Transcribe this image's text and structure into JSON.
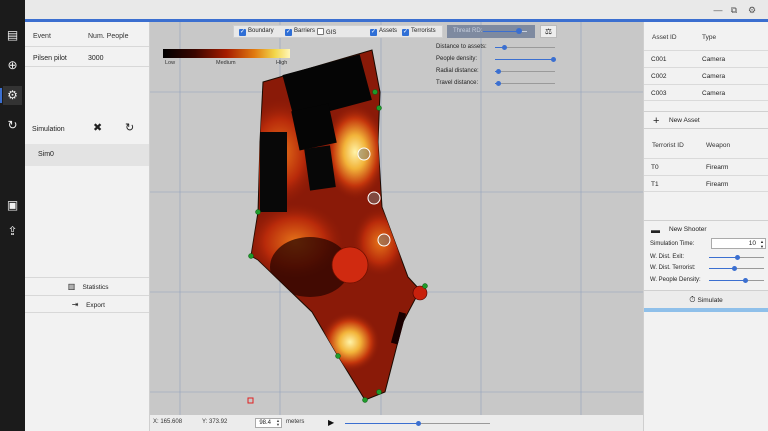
{
  "window_controls": [
    "—",
    "⧉",
    "⚙"
  ],
  "toolbar": {
    "active_index": 2
  },
  "events": {
    "headers": [
      "Event",
      "Num. People"
    ],
    "rows": [
      [
        "Pilsen pilot",
        "3000"
      ]
    ]
  },
  "simulation": {
    "label": "Simulation",
    "items": [
      "Sim0"
    ]
  },
  "actions": {
    "statistics": "Statistics",
    "export": "Export"
  },
  "layers": {
    "boundary": "Boundary",
    "barriers": "Barriers",
    "gis": "GIS",
    "assets": "Assets",
    "terrorists": "Terrorists",
    "checked": {
      "boundary": true,
      "barriers": true,
      "gis": false,
      "assets": true,
      "terrorists": true
    }
  },
  "threat": {
    "label": "Threat RD:",
    "value": 0.82
  },
  "legend": {
    "low": "Low",
    "medium": "Medium",
    "high": "High"
  },
  "params": [
    {
      "label": "Distance to assets:",
      "value": 0.15
    },
    {
      "label": "People density:",
      "value": 0.97
    },
    {
      "label": "Radial distance:",
      "value": 0.05
    },
    {
      "label": "Travel distance:",
      "value": 0.05
    }
  ],
  "status": {
    "x": "X: 165.608",
    "y": "Y: 373.92",
    "scale": "98.4",
    "unit": "meters",
    "timeline": 0.5
  },
  "assets": {
    "headers": [
      "Asset ID",
      "Type"
    ],
    "rows": [
      [
        "C001",
        "Camera"
      ],
      [
        "C002",
        "Camera"
      ],
      [
        "C003",
        "Camera"
      ]
    ],
    "new_label": "New Asset"
  },
  "terrorists": {
    "headers": [
      "Terrorist ID",
      "Weapon"
    ],
    "rows": [
      [
        "T0",
        "Firearm"
      ],
      [
        "T1",
        "Firearm"
      ]
    ],
    "new_label": "New Shooter"
  },
  "sim_params": {
    "time_label": "Simulation Time:",
    "time_value": "10",
    "sliders": [
      {
        "label": "W. Dist. Exit:",
        "value": 0.5
      },
      {
        "label": "W. Dist. Terrorist:",
        "value": 0.45
      },
      {
        "label": "W. People Density:",
        "value": 0.65
      }
    ],
    "simulate": "Simulate"
  }
}
